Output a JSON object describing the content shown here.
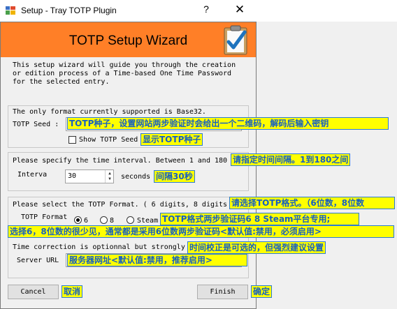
{
  "window": {
    "title": "Setup - Tray TOTP Plugin",
    "help_glyph": "?",
    "close_glyph": "✕"
  },
  "banner": {
    "title": "TOTP Setup Wizard",
    "color": "#ff7f27"
  },
  "intro": "This setup wizard will guide you through the creation\nor edition process of a Time-based One Time Password\nfor the selected entry.",
  "seed_group": {
    "info": "The only format currently supported is Base32.",
    "label": "TOTP Seed :",
    "value": "",
    "show_seed_label": "Show TOTP Seed",
    "note_seed": "TOTP种子，设置网站两步验证时会给出一个二维码，解码后输入密钥",
    "note_show_seed": "显示TOTP种子"
  },
  "interval_group": {
    "info": "Please specify the time interval. Between 1 and 180",
    "label": "Interva",
    "value": "30",
    "unit": "seconds",
    "note_info": "请指定时间间隔。1到180之间",
    "note_interval": "间隔30秒"
  },
  "format_group": {
    "info": "Please select the TOTP Format. ( 6 digits, 8 digits",
    "label": "TOTP Format",
    "options": [
      "6",
      "8",
      "Steam"
    ],
    "selected": "6",
    "note_select": "请选择TOTP格式。（6位数，8位数",
    "note_steam": "TOTP格式两步验证码6 8 Steam平台专用;",
    "note_explain": "选择6，8位数的很少见，通常都是采用6位数两步验证码<默认值:禁用，必须启用>"
  },
  "time_group": {
    "info": "Time correction is optionnal but strongly",
    "label": "Server URL",
    "value": "",
    "note_info": "时间校正是可选的，但强烈建议设置",
    "note_url": "服务器网址<默认值:禁用，推荐启用>"
  },
  "footer": {
    "cancel": "Cancel",
    "finish": "Finish",
    "note_cancel": "取消",
    "note_finish": "确定"
  },
  "colors": {
    "note_bg": "#ffff00",
    "note_text": "#1660c0",
    "check_mark": "#1e73be"
  }
}
